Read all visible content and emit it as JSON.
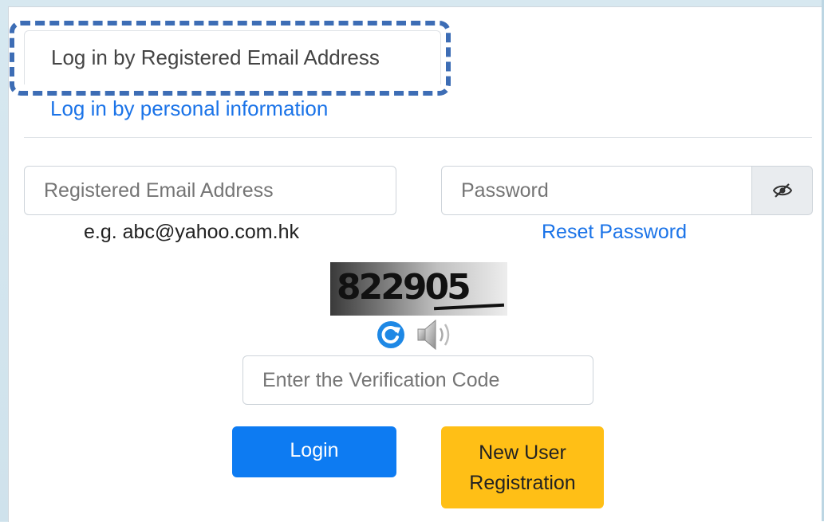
{
  "tabs": {
    "active_label": "Log in by Registered Email Address",
    "other_label": "Log in by personal information"
  },
  "email": {
    "placeholder": "Registered Email Address",
    "hint": "e.g. abc@yahoo.com.hk"
  },
  "password": {
    "placeholder": "Password",
    "toggle_icon": "eye-slash-icon",
    "reset_label": "Reset Password"
  },
  "captcha": {
    "code_image_text": "822905",
    "refresh_icon": "refresh-icon",
    "audio_icon": "speaker-icon",
    "placeholder": "Enter the Verification Code"
  },
  "actions": {
    "login_label": "Login",
    "register_label": "New User Registration"
  },
  "colors": {
    "link": "#1a73e8",
    "primary": "#0d7bf2",
    "warning": "#ffbf16",
    "highlight": "#3d6db5"
  }
}
